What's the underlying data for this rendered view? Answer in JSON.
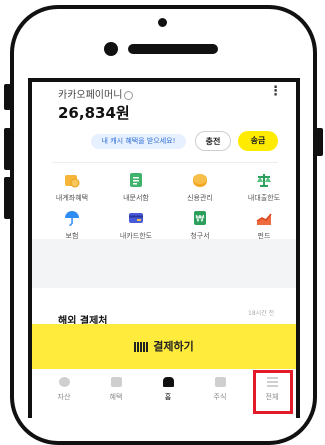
{
  "wallet": {
    "title": "카카오페이머니",
    "balance": "26,834원",
    "more_icon": "⋮",
    "promo": "내 캐시 혜택을 받으세요!",
    "charge_label": "충전",
    "send_label": "송금"
  },
  "services": [
    {
      "label": "내계좌혜택",
      "icon": "coin-icon"
    },
    {
      "label": "내문서함",
      "icon": "document-icon"
    },
    {
      "label": "신용관리",
      "icon": "credit-icon"
    },
    {
      "label": "내대출한도",
      "icon": "scale-icon"
    },
    {
      "label": "보험",
      "icon": "umbrella-icon"
    },
    {
      "label": "내카드한도",
      "icon": "card-icon"
    },
    {
      "label": "청구서",
      "icon": "bill-icon"
    },
    {
      "label": "펀드",
      "icon": "chart-up-icon"
    }
  ],
  "overseas": {
    "title": "해외 결제처",
    "time": "18시간 전"
  },
  "pay_button": {
    "label": "결제하기"
  },
  "tabs": [
    {
      "label": "자산"
    },
    {
      "label": "혜택"
    },
    {
      "label": "홈"
    },
    {
      "label": "주식"
    },
    {
      "label": "전체"
    }
  ],
  "colors": {
    "accent": "#ffeb00",
    "pay_bar": "#ffeb3b",
    "highlight": "#e11b2a",
    "promo_text": "#2f6fd6"
  }
}
